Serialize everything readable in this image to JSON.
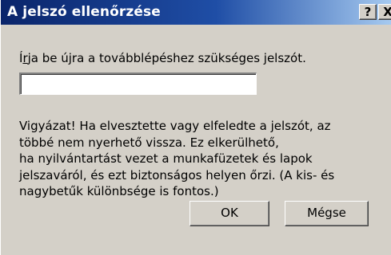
{
  "window": {
    "title": "A jelszó ellenőrzése",
    "help_label": "?",
    "close_label": "X"
  },
  "prompt": {
    "prefix": "Í",
    "accel": "r",
    "rest": "ja be újra a továbblépéshez szükséges jelszót."
  },
  "password_field": {
    "value": ""
  },
  "warning": {
    "lines": [
      "Vigyázat! Ha elvesztette vagy elfeledte a jelszót, az",
      "többé nem nyerhető vissza. Ez elkerülhető,",
      "ha nyilvántartást vezet a munkafüzetek és lapok",
      "jelszaváról, és ezt biztonságos helyen őrzi. (A kis- és",
      "nagybetűk különbsége is fontos.)"
    ]
  },
  "buttons": {
    "ok_label": "OK",
    "cancel_label": "Mégse"
  },
  "colors": {
    "titlebar_start": "#0a246a",
    "titlebar_end": "#a6caf0",
    "dialog_face": "#d4d0c8"
  }
}
